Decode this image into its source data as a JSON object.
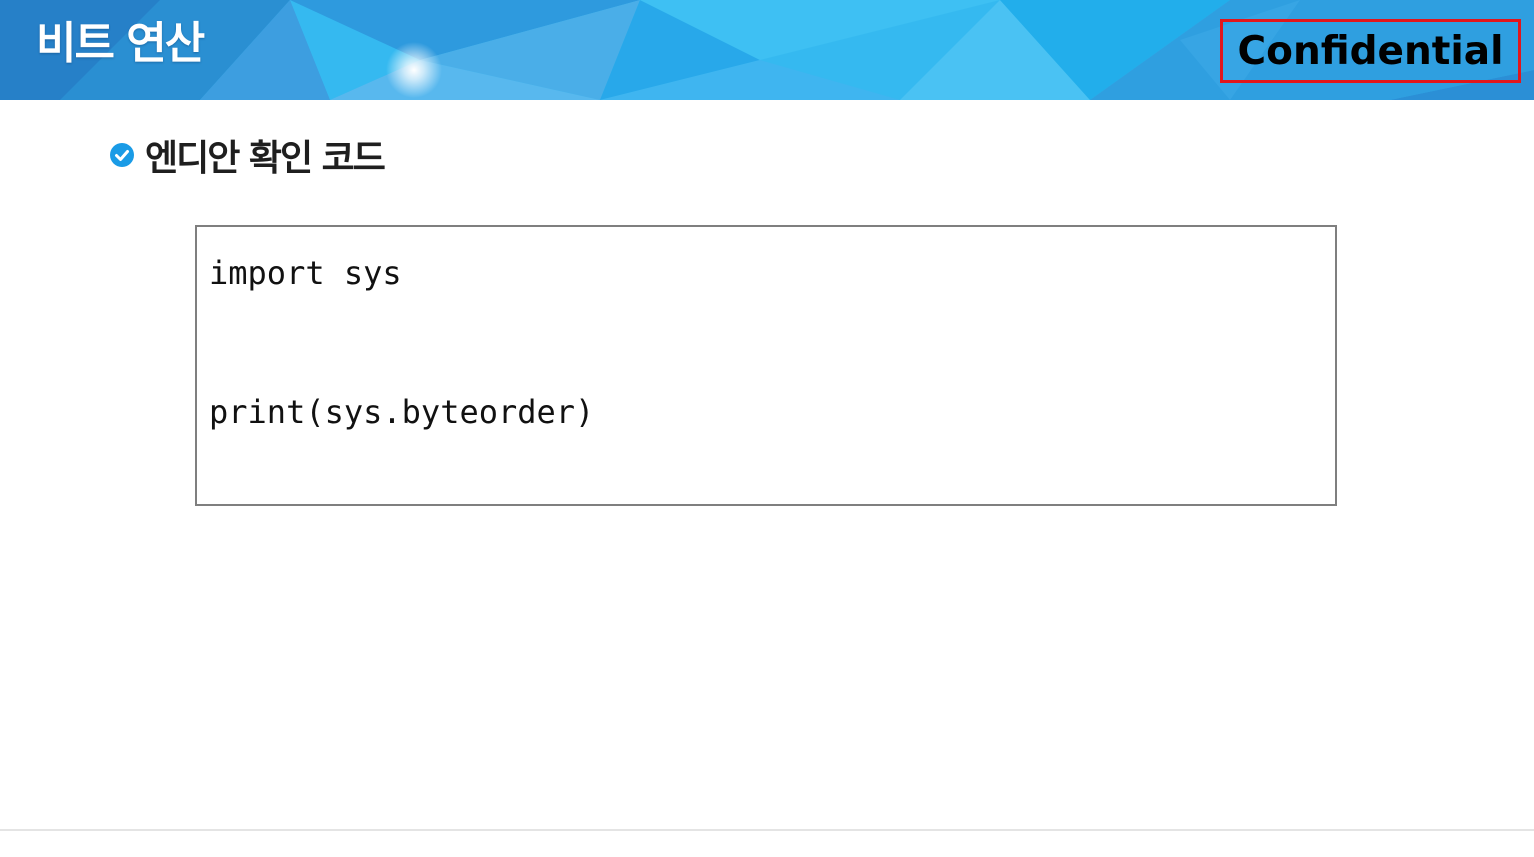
{
  "header": {
    "title": "비트 연산",
    "badge": "Confidential",
    "badge_border_color": "#e2161b",
    "accent_color": "#33b7ee"
  },
  "content": {
    "subheading_icon": "check-circle-icon",
    "subheading": "엔디안 확인 코드",
    "code_lines": [
      "import sys",
      "print(sys.byteorder)"
    ]
  }
}
